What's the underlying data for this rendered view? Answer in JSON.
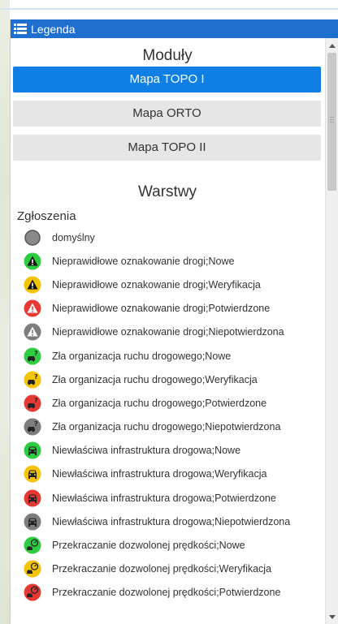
{
  "panel": {
    "title": "Legenda"
  },
  "modules": {
    "title": "Moduły",
    "buttons": [
      {
        "label": "Mapa TOPO I",
        "active": true
      },
      {
        "label": "Mapa ORTO",
        "active": false
      },
      {
        "label": "Mapa TOPO II",
        "active": false
      }
    ]
  },
  "layers": {
    "title": "Warstwy",
    "group_title": "Zgłoszenia",
    "items": [
      {
        "label": "domyślny",
        "icon": "default-circle-icon",
        "kind": "default",
        "color": "#8a8a8a"
      },
      {
        "label": "Nieprawidłowe oznakowanie drogi;Nowe",
        "icon": "warning-sign-icon",
        "kind": "warning",
        "color": "#2ecc40"
      },
      {
        "label": "Nieprawidłowe oznakowanie drogi;Weryfikacja",
        "icon": "warning-sign-icon",
        "kind": "warning",
        "color": "#f5c400"
      },
      {
        "label": "Nieprawidłowe oznakowanie drogi;Potwierdzone",
        "icon": "warning-sign-icon",
        "kind": "warning",
        "color": "#e53935"
      },
      {
        "label": "Nieprawidłowe oznakowanie drogi;Niepotwierdzona",
        "icon": "warning-sign-icon",
        "kind": "warning",
        "color": "#7d7d7d"
      },
      {
        "label": "Zła organizacja ruchu drogowego;Nowe",
        "icon": "car-question-icon",
        "kind": "carq",
        "color": "#2ecc40"
      },
      {
        "label": "Zła organizacja ruchu drogowego;Weryfikacja",
        "icon": "car-question-icon",
        "kind": "carq",
        "color": "#f5c400"
      },
      {
        "label": "Zła organizacja ruchu drogowego;Potwierdzone",
        "icon": "car-question-icon",
        "kind": "carq",
        "color": "#e53935"
      },
      {
        "label": "Zła organizacja ruchu drogowego;Niepotwierdzona",
        "icon": "car-question-icon",
        "kind": "carq",
        "color": "#7d7d7d"
      },
      {
        "label": "Niewłaściwa infrastruktura drogowa;Nowe",
        "icon": "car-front-icon",
        "kind": "car",
        "color": "#2ecc40"
      },
      {
        "label": "Niewłaściwa infrastruktura drogowa;Weryfikacja",
        "icon": "car-front-icon",
        "kind": "car",
        "color": "#f5c400"
      },
      {
        "label": "Niewłaściwa infrastruktura drogowa;Potwierdzone",
        "icon": "car-front-icon",
        "kind": "car",
        "color": "#e53935"
      },
      {
        "label": "Niewłaściwa infrastruktura drogowa;Niepotwierdzona",
        "icon": "car-front-icon",
        "kind": "car",
        "color": "#7d7d7d"
      },
      {
        "label": "Przekraczanie dozwolonej prędkości;Nowe",
        "icon": "speed-car-icon",
        "kind": "speed",
        "color": "#2ecc40"
      },
      {
        "label": "Przekraczanie dozwolonej prędkości;Weryfikacja",
        "icon": "speed-car-icon",
        "kind": "speed",
        "color": "#f5c400"
      },
      {
        "label": "Przekraczanie dozwolonej prędkości;Potwierdzone",
        "icon": "speed-car-icon",
        "kind": "speed",
        "color": "#e53935"
      }
    ]
  }
}
